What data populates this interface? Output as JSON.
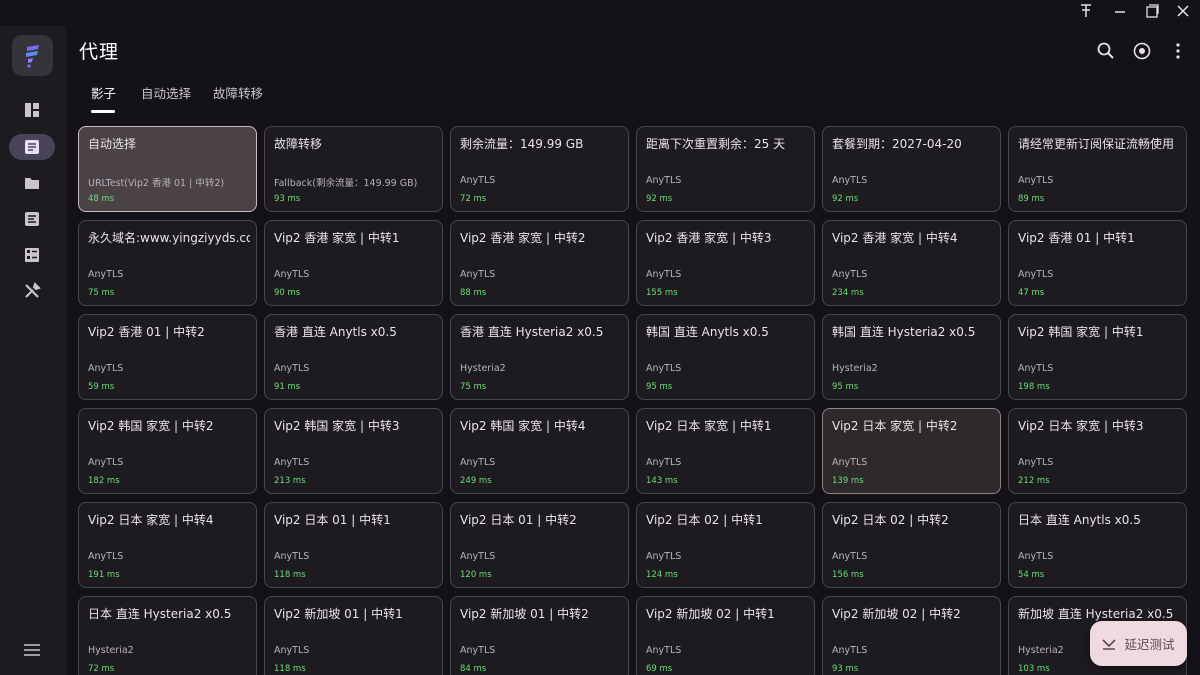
{
  "window": {
    "pin_icon": "pin-icon",
    "minimize_icon": "minimize-icon",
    "maximize_icon": "maximize-icon",
    "close_icon": "close-icon"
  },
  "sidebar": {
    "logo_icon": "app-logo",
    "items": [
      {
        "name": "dashboard",
        "icon": "dashboard-icon",
        "active": false
      },
      {
        "name": "proxies",
        "icon": "proxies-icon",
        "active": true
      },
      {
        "name": "profiles",
        "icon": "folder-icon",
        "active": false
      },
      {
        "name": "requests",
        "icon": "requests-icon",
        "active": false
      },
      {
        "name": "resources",
        "icon": "resources-icon",
        "active": false
      },
      {
        "name": "tools",
        "icon": "tools-icon",
        "active": false
      }
    ],
    "menu_icon": "menu-icon"
  },
  "header": {
    "title": "代理",
    "actions": [
      "search-icon",
      "target-icon",
      "more-vert-icon"
    ]
  },
  "tabs": [
    {
      "label": "影子",
      "active": true
    },
    {
      "label": "自动选择",
      "active": false
    },
    {
      "label": "故障转移",
      "active": false
    }
  ],
  "colors": {
    "accent": "#efdadf",
    "delay_green": "#6ddc7a",
    "selected_card": "#4b4246"
  },
  "proxies": [
    {
      "name": "自动选择",
      "type": "URLTest(Vip2 香港 01 | 中转2)",
      "delay": "48 ms",
      "state": "selected"
    },
    {
      "name": "故障转移",
      "type": "Fallback(剩余流量：149.99 GB)",
      "delay": "93 ms",
      "state": ""
    },
    {
      "name": "剩余流量：149.99 GB",
      "type": "AnyTLS",
      "delay": "72 ms",
      "state": ""
    },
    {
      "name": "距离下次重置剩余：25 天",
      "type": "AnyTLS",
      "delay": "92 ms",
      "state": ""
    },
    {
      "name": "套餐到期：2027-04-20",
      "type": "AnyTLS",
      "delay": "92 ms",
      "state": ""
    },
    {
      "name": "请经常更新订阅保证流畅使用",
      "type": "AnyTLS",
      "delay": "89 ms",
      "state": ""
    },
    {
      "name": "永久域名:www.yingziyyds.com",
      "type": "AnyTLS",
      "delay": "75 ms",
      "state": ""
    },
    {
      "name": "Vip2 香港 家宽 | 中转1",
      "type": "AnyTLS",
      "delay": "90 ms",
      "state": ""
    },
    {
      "name": "Vip2 香港 家宽 | 中转2",
      "type": "AnyTLS",
      "delay": "88 ms",
      "state": ""
    },
    {
      "name": "Vip2 香港 家宽 | 中转3",
      "type": "AnyTLS",
      "delay": "155 ms",
      "state": ""
    },
    {
      "name": "Vip2 香港 家宽 | 中转4",
      "type": "AnyTLS",
      "delay": "234 ms",
      "state": ""
    },
    {
      "name": "Vip2 香港 01 | 中转1",
      "type": "AnyTLS",
      "delay": "47 ms",
      "state": ""
    },
    {
      "name": "Vip2 香港 01 | 中转2",
      "type": "AnyTLS",
      "delay": "59 ms",
      "state": ""
    },
    {
      "name": "香港 直连 Anytls x0.5",
      "type": "AnyTLS",
      "delay": "91 ms",
      "state": ""
    },
    {
      "name": "香港 直连 Hysteria2 x0.5",
      "type": "Hysteria2",
      "delay": "75 ms",
      "state": ""
    },
    {
      "name": "韩国 直连 Anytls x0.5",
      "type": "AnyTLS",
      "delay": "95 ms",
      "state": ""
    },
    {
      "name": "韩国 直连 Hysteria2 x0.5",
      "type": "Hysteria2",
      "delay": "95 ms",
      "state": ""
    },
    {
      "name": "Vip2 韩国 家宽 | 中转1",
      "type": "AnyTLS",
      "delay": "198 ms",
      "state": ""
    },
    {
      "name": "Vip2 韩国 家宽 | 中转2",
      "type": "AnyTLS",
      "delay": "182 ms",
      "state": ""
    },
    {
      "name": "Vip2 韩国 家宽 | 中转3",
      "type": "AnyTLS",
      "delay": "213 ms",
      "state": ""
    },
    {
      "name": "Vip2 韩国 家宽 | 中转4",
      "type": "AnyTLS",
      "delay": "249 ms",
      "state": ""
    },
    {
      "name": "Vip2 日本 家宽 | 中转1",
      "type": "AnyTLS",
      "delay": "143 ms",
      "state": ""
    },
    {
      "name": "Vip2 日本 家宽 | 中转2",
      "type": "AnyTLS",
      "delay": "139 ms",
      "state": "highlight"
    },
    {
      "name": "Vip2 日本 家宽 | 中转3",
      "type": "AnyTLS",
      "delay": "212 ms",
      "state": ""
    },
    {
      "name": "Vip2 日本 家宽 | 中转4",
      "type": "AnyTLS",
      "delay": "191 ms",
      "state": ""
    },
    {
      "name": "Vip2 日本 01 | 中转1",
      "type": "AnyTLS",
      "delay": "118 ms",
      "state": ""
    },
    {
      "name": "Vip2 日本 01 | 中转2",
      "type": "AnyTLS",
      "delay": "120 ms",
      "state": ""
    },
    {
      "name": "Vip2 日本 02 | 中转1",
      "type": "AnyTLS",
      "delay": "124 ms",
      "state": ""
    },
    {
      "name": "Vip2 日本 02 | 中转2",
      "type": "AnyTLS",
      "delay": "156 ms",
      "state": ""
    },
    {
      "name": "日本 直连 Anytls x0.5",
      "type": "AnyTLS",
      "delay": "54 ms",
      "state": ""
    },
    {
      "name": "日本 直连 Hysteria2 x0.5",
      "type": "Hysteria2",
      "delay": "72 ms",
      "state": ""
    },
    {
      "name": "Vip2 新加坡 01 | 中转1",
      "type": "AnyTLS",
      "delay": "118 ms",
      "state": ""
    },
    {
      "name": "Vip2 新加坡 01 | 中转2",
      "type": "AnyTLS",
      "delay": "84 ms",
      "state": ""
    },
    {
      "name": "Vip2 新加坡 02 | 中转1",
      "type": "AnyTLS",
      "delay": "69 ms",
      "state": ""
    },
    {
      "name": "Vip2 新加坡 02 | 中转2",
      "type": "AnyTLS",
      "delay": "93 ms",
      "state": ""
    },
    {
      "name": "新加坡 直连 Hysteria2 x0.5",
      "type": "Hysteria2",
      "delay": "103 ms",
      "state": ""
    }
  ],
  "fab": {
    "label": "延迟测试",
    "icon": "speed-test-icon"
  }
}
